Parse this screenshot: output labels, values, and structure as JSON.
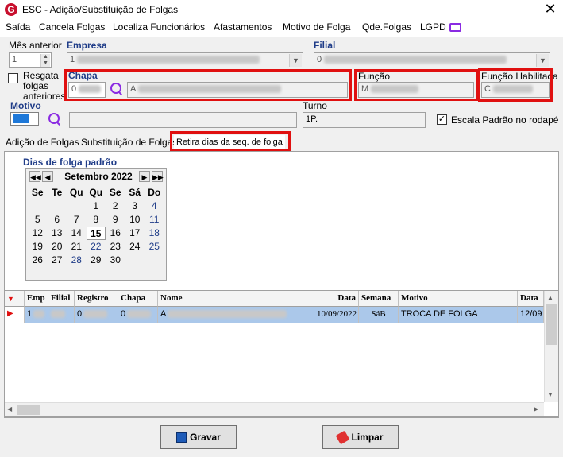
{
  "window": {
    "title": "ESC - Adição/Substituição de Folgas",
    "app_icon_letter": "G"
  },
  "menu": [
    "Saída",
    "Cancela Folgas",
    "Localiza Funcionários",
    "Afastamentos",
    "Motivo de Folga",
    "Qde.Folgas",
    "LGPD"
  ],
  "form": {
    "mes_anterior_label": "Mês anterior",
    "mes_anterior_value": "1",
    "empresa_label": "Empresa",
    "empresa_value": "1",
    "filial_label": "Filial",
    "filial_value": "0",
    "resgata_label": "Resgata folgas anteriores",
    "chapa_label": "Chapa",
    "chapa_value": "0",
    "chapa_nome_value": "A",
    "funcao_label": "Função",
    "funcao_value": "M",
    "funcao_habilitada_label": "Função Habilitada",
    "funcao_habilitada_value": "C",
    "motivo_label": "Motivo",
    "motivo_color": "#1e78d8",
    "turno_label": "Turno",
    "turno_value": "1P.",
    "escala_label": "Escala Padrão no rodapé",
    "escala_checked": "✓"
  },
  "tabs": [
    "Adição de Folgas",
    "Substituição de Folgas",
    "Retira dias da seq. de folga"
  ],
  "calendar": {
    "title": "Dias de folga padrão",
    "month": "Setembro 2022",
    "weekdays": [
      "Se",
      "Te",
      "Qu",
      "Qu",
      "Se",
      "Sá",
      "Do"
    ],
    "weeks": [
      [
        "",
        "",
        "",
        "1",
        "2",
        "3",
        "4"
      ],
      [
        "5",
        "6",
        "7",
        "8",
        "9",
        "10",
        "11"
      ],
      [
        "12",
        "13",
        "14",
        "15",
        "16",
        "17",
        "18"
      ],
      [
        "19",
        "20",
        "21",
        "22",
        "23",
        "24",
        "25"
      ],
      [
        "26",
        "27",
        "28",
        "29",
        "30",
        "",
        ""
      ]
    ],
    "today": "15"
  },
  "grid": {
    "columns": [
      "Emp",
      "Filial",
      "Registro",
      "Chapa",
      "Nome",
      "Data",
      "Semana",
      "Motivo",
      "Data"
    ],
    "row": {
      "emp": "1",
      "filial": "",
      "registro": "0",
      "chapa": "0",
      "nome": "A",
      "data": "10/09/2022",
      "semana": "SáB",
      "motivo": "TROCA DE FOLGA",
      "data2": "12/09"
    }
  },
  "buttons": {
    "gravar": "Gravar",
    "limpar": "Limpar"
  }
}
